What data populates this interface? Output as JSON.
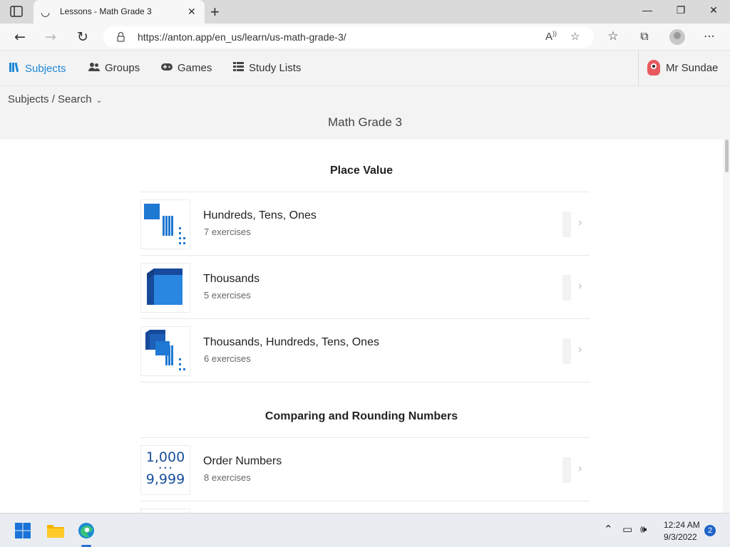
{
  "browser": {
    "tab_title": "Lessons - Math Grade 3",
    "url": "https://anton.app/en_us/learn/us-math-grade-3/"
  },
  "appnav": {
    "items": [
      {
        "label": "Subjects",
        "icon": "books-icon",
        "active": true
      },
      {
        "label": "Groups",
        "icon": "users-icon",
        "active": false
      },
      {
        "label": "Games",
        "icon": "gamepad-icon",
        "active": false
      },
      {
        "label": "Study Lists",
        "icon": "list-icon",
        "active": false
      }
    ],
    "user_name": "Mr Sundae"
  },
  "breadcrumb": "Subjects / Search",
  "page_title": "Math Grade 3",
  "sections": [
    {
      "title": "Place Value",
      "lessons": [
        {
          "title": "Hundreds, Tens, Ones",
          "sub": "7 exercises"
        },
        {
          "title": "Thousands",
          "sub": "5 exercises"
        },
        {
          "title": "Thousands, Hundreds, Tens, Ones",
          "sub": "6 exercises"
        }
      ]
    },
    {
      "title": "Comparing and Rounding Numbers",
      "lessons": [
        {
          "title": "Order Numbers",
          "sub": "8 exercises",
          "thumb_top": "1,000",
          "thumb_dots": "• • •",
          "thumb_bottom": "9,999"
        }
      ]
    }
  ],
  "taskbar": {
    "time": "12:24 AM",
    "date": "9/3/2022",
    "notifications": "2"
  },
  "colors": {
    "accent": "#1e88d7",
    "block_blue": "#1f78d1",
    "block_dark": "#174a9c"
  }
}
